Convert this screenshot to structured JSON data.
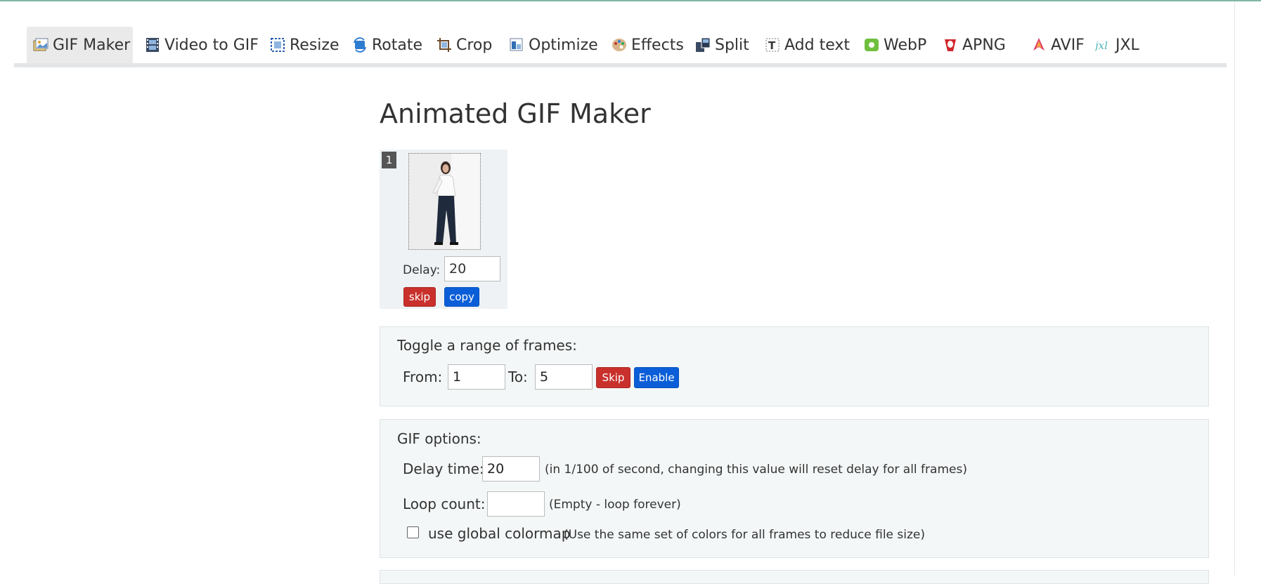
{
  "tabs": [
    {
      "label": "GIF Maker",
      "icon": "gif-maker-icon"
    },
    {
      "label": "Video to GIF",
      "icon": "film-icon"
    },
    {
      "label": "Resize",
      "icon": "resize-icon"
    },
    {
      "label": "Rotate",
      "icon": "rotate-icon"
    },
    {
      "label": "Crop",
      "icon": "crop-icon"
    },
    {
      "label": "Optimize",
      "icon": "optimize-icon"
    },
    {
      "label": "Effects",
      "icon": "palette-icon"
    },
    {
      "label": "Split",
      "icon": "split-icon"
    },
    {
      "label": "Add text",
      "icon": "add-text-icon"
    },
    {
      "label": "WebP",
      "icon": "webp-icon"
    },
    {
      "label": "APNG",
      "icon": "apng-icon"
    },
    {
      "label": "AVIF",
      "icon": "avif-icon"
    },
    {
      "label": "JXL",
      "icon": "jxl-icon"
    }
  ],
  "page": {
    "title": "Animated GIF Maker"
  },
  "frame": {
    "number": "1",
    "delay_label": "Delay:",
    "delay_value": "20",
    "skip_label": "skip",
    "copy_label": "copy"
  },
  "range": {
    "title": "Toggle a range of frames:",
    "from_label": "From:",
    "from_value": "1",
    "to_label": "To:",
    "to_value": "5",
    "skip_label": "Skip",
    "enable_label": "Enable"
  },
  "options": {
    "title": "GIF options:",
    "delay_label": "Delay time:",
    "delay_value": "20",
    "delay_hint": "(in 1/100 of second, changing this value will reset delay for all frames)",
    "loop_label": "Loop count:",
    "loop_value": "",
    "loop_hint": "(Empty - loop forever)",
    "colormap_label": "use global colormap",
    "colormap_hint": "(Use the same set of colors for all frames to reduce file size)",
    "colormap_checked": false
  },
  "colors": {
    "accent_red": "#c9302c",
    "accent_blue": "#0b5ed7",
    "panel_bg": "#f4f7f7",
    "top_line": "#7fb8a4"
  }
}
